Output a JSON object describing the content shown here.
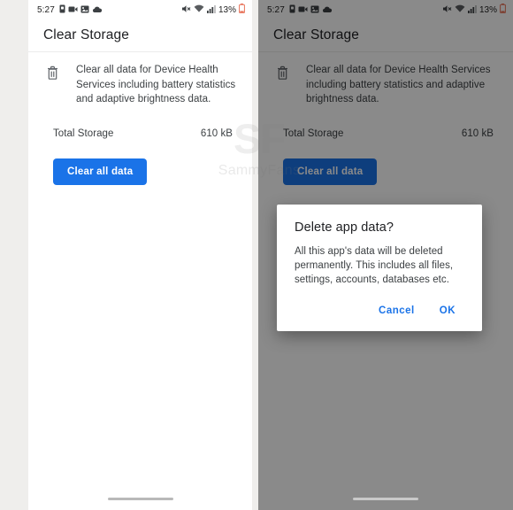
{
  "status_bar": {
    "time": "5:27",
    "battery_percent": "13%",
    "left_icons": [
      "sim-card-icon",
      "video-camera-icon",
      "gallery-icon",
      "cloud-icon"
    ],
    "right_icons": [
      "mute-icon",
      "wifi-icon",
      "cellular-signal-icon",
      "battery-icon"
    ]
  },
  "app_bar": {
    "title": "Clear Storage"
  },
  "content": {
    "icon": "trash-icon",
    "description": "Clear all data for Device Health Services including battery statistics and adaptive brightness data.",
    "storage_label": "Total Storage",
    "storage_value": "610 kB",
    "clear_button": "Clear all data"
  },
  "dialog": {
    "title": "Delete app data?",
    "message": "All this app's data will be deleted permanently. This includes all files, settings, accounts, databases etc.",
    "cancel_label": "Cancel",
    "ok_label": "OK"
  },
  "watermark": {
    "logo": "SF",
    "name": "SammyFans"
  },
  "colors": {
    "accent_blue": "#1a73e8",
    "page_background": "#efeeec",
    "surface": "#ffffff",
    "primary_text": "#202124",
    "secondary_text": "#3c4043",
    "scrim": "rgba(0,0,0,0.46)"
  }
}
